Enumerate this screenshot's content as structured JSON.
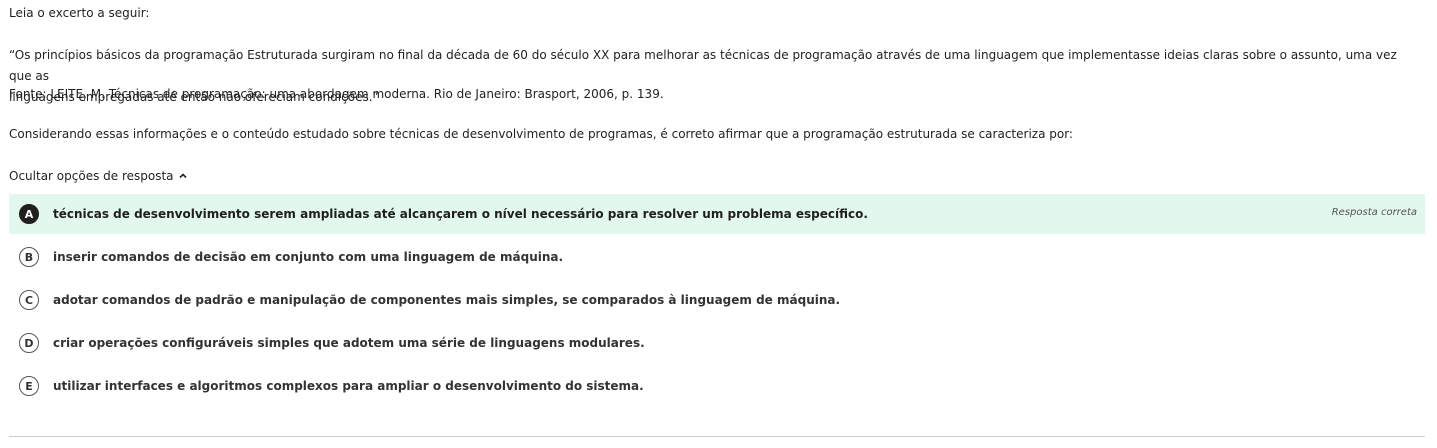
{
  "question": {
    "intro": "Leia o excerto a seguir:",
    "quote_line1": "“Os princípios básicos da programação Estruturada surgiram no final da década de 60 do século XX para melhorar as técnicas de programação através de uma linguagem que implementasse ideias claras sobre o assunto, uma vez que as",
    "quote_line2": "linguagens empregadas até então não ofereciam condições.”",
    "source": "Fonte: LEITE, M. Técnicas de programação: uma abordagem moderna. Rio de Janeiro: Brasport, 2006, p. 139.",
    "prompt": "Considerando essas informações e o conteúdo estudado sobre técnicas de desenvolvimento de programas, é correto afirmar que a programação estruturada se caracteriza por:"
  },
  "toggle": {
    "label": "Ocultar opções de resposta",
    "icon": "chevron-up-icon"
  },
  "options": [
    {
      "letter": "A",
      "text": "técnicas de desenvolvimento serem ampliadas até alcançarem o nível necessário para resolver um problema específico.",
      "status": "Resposta correta"
    },
    {
      "letter": "B",
      "text": "inserir comandos de decisão em conjunto com uma linguagem de máquina."
    },
    {
      "letter": "C",
      "text": "adotar comandos de padrão e manipulação de componentes mais simples, se comparados à linguagem de máquina."
    },
    {
      "letter": "D",
      "text": "criar operações configuráveis simples que adotem uma série de linguagens modulares."
    },
    {
      "letter": "E",
      "text": "utilizar interfaces e algoritmos complexos para ampliar o desenvolvimento do sistema."
    }
  ],
  "colors": {
    "correct_bg": "#e2f8ec",
    "correct_badge": "#1f1f1f",
    "text": "#222222",
    "divider": "#cccccc"
  }
}
